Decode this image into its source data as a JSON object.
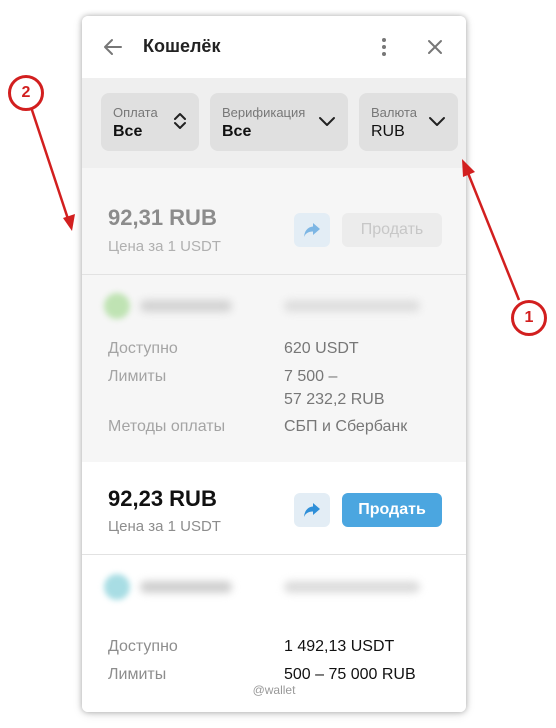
{
  "header": {
    "title": "Кошелёк",
    "back_icon": "arrow-left-icon",
    "menu_icon": "more-vertical-icon",
    "close_icon": "close-icon"
  },
  "filters": {
    "payment": {
      "label": "Оплата",
      "value": "Все",
      "icon": "sort-updown-icon"
    },
    "verification": {
      "label": "Верификация",
      "value": "Все",
      "icon": "chevron-down-icon"
    },
    "currency": {
      "label": "Валюта",
      "value": "RUB",
      "icon": "chevron-down-icon"
    }
  },
  "offers": [
    {
      "price": "92,31 RUB",
      "price_caption": "Цена за 1 USDT",
      "sell_label": "Продать",
      "available_label": "Доступно",
      "available_value": "620 USDT",
      "limits_label": "Лимиты",
      "limits_line1": "7 500 –",
      "limits_line2": "57 232,2 RUB",
      "methods_label": "Методы оплаты",
      "methods_value": "СБП и Сбербанк"
    },
    {
      "price": "92,23 RUB",
      "price_caption": "Цена за 1 USDT",
      "sell_label": "Продать",
      "available_label": "Доступно",
      "available_value": "1 492,13 USDT",
      "limits_label": "Лимиты",
      "limits_value": "500 – 75 000 RUB"
    }
  ],
  "footer": {
    "watermark": "@wallet"
  },
  "annotations": {
    "badge_1": "1",
    "badge_2": "2"
  },
  "colors": {
    "accent_blue": "#4ba6e0",
    "annotation_red": "#d21f1f",
    "filter_bg": "#efefef"
  }
}
